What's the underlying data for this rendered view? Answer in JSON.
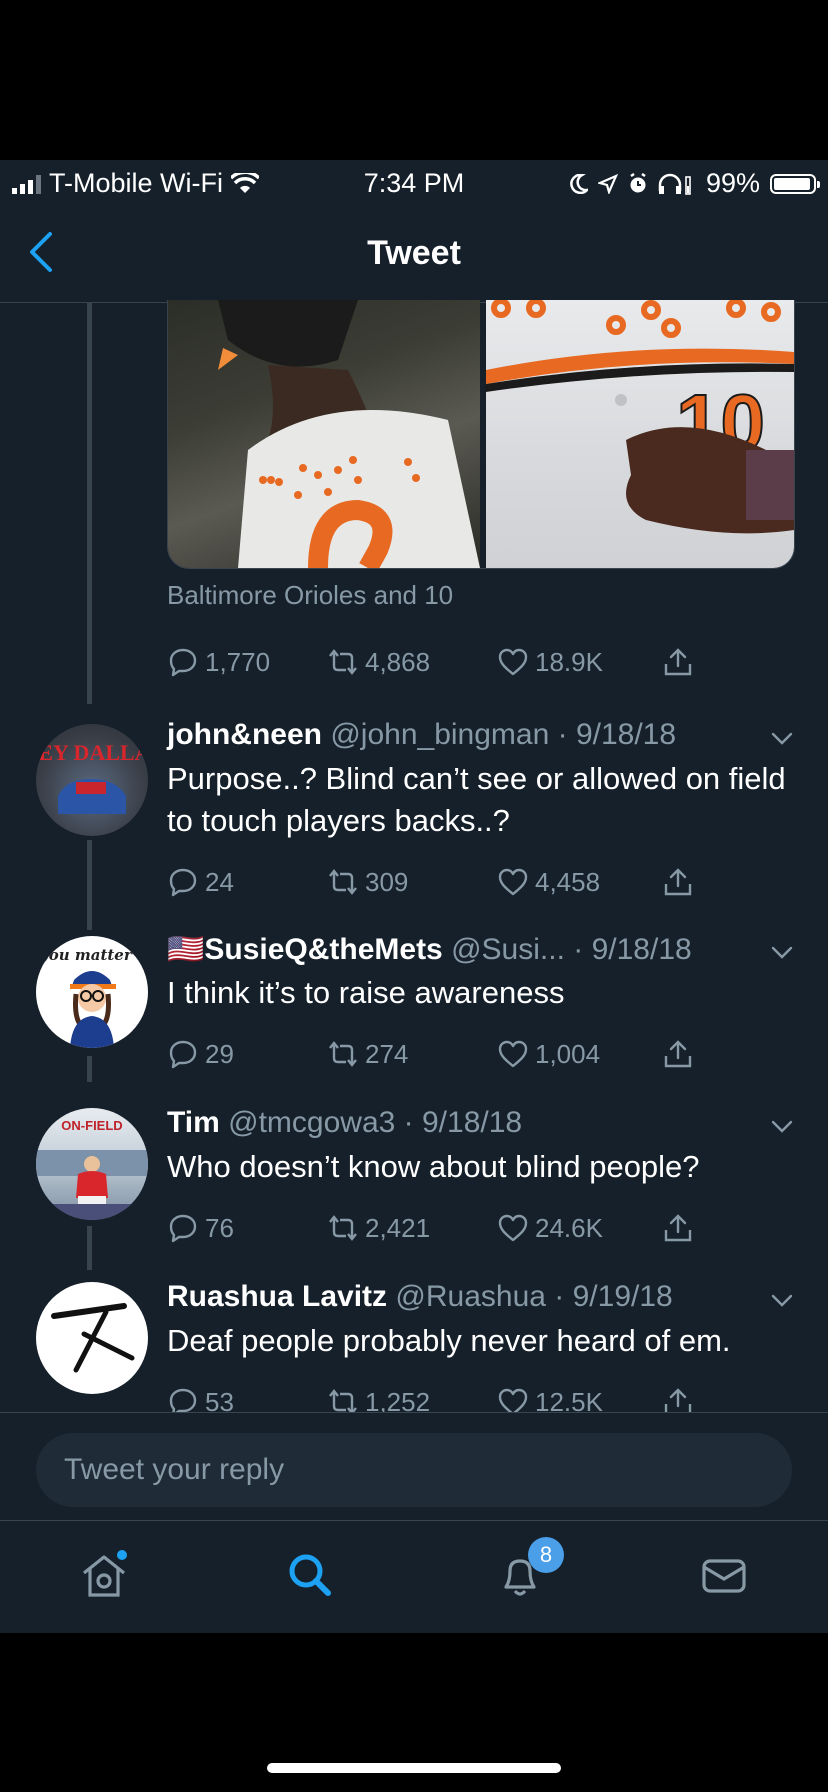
{
  "status_bar": {
    "carrier": "T-Mobile Wi-Fi",
    "time": "7:34 PM",
    "battery": "99%"
  },
  "nav": {
    "title": "Tweet"
  },
  "tweet": {
    "caption": "Baltimore Orioles and 10",
    "stats": {
      "replies": "1,770",
      "retweets": "4,868",
      "likes": "18.9K"
    }
  },
  "replies": [
    {
      "name": "john&neen",
      "handle": "@john_bingman",
      "date": "9/18/18",
      "text": "Purpose..?  Blind can’t see or allowed on field to touch players backs..?",
      "replies": "24",
      "retweets": "309",
      "likes": "4,458"
    },
    {
      "name": "🇺🇸SusieQ&theMets",
      "handle": "@Susi...",
      "date": "9/18/18",
      "text": "I think it’s to raise awareness",
      "replies": "29",
      "retweets": "274",
      "likes": "1,004"
    },
    {
      "name": "Tim",
      "handle": "@tmcgowa3",
      "date": "9/18/18",
      "text": "Who doesn’t know about blind people?",
      "replies": "76",
      "retweets": "2,421",
      "likes": "24.6K"
    },
    {
      "name": "Ruashua Lavitz",
      "handle": "@Ruashua",
      "date": "9/19/18",
      "text": "Deaf people probably never heard of em.",
      "replies": "53",
      "retweets": "1,252",
      "likes": "12.5K"
    }
  ],
  "avatars": {
    "a1": "HEY DALLAS",
    "a2": "you matter",
    "a3": "ON-FIELD"
  },
  "reply_input": {
    "placeholder": "Tweet your reply"
  },
  "tabbar": {
    "notification_count": "8"
  },
  "colors": {
    "background": "#15202b",
    "accent": "#1da1f2",
    "secondary_text": "#8899a6",
    "divider": "#38444d"
  }
}
